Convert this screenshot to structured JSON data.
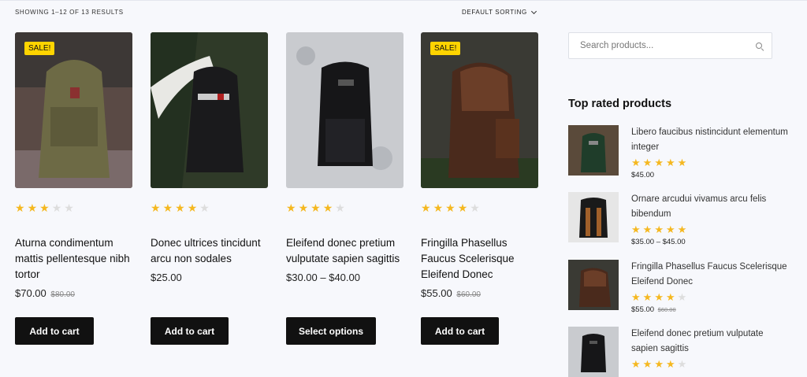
{
  "toolbar": {
    "results_text": "SHOWING 1–12 OF 13 RESULTS",
    "sort_label": "DEFAULT SORTING"
  },
  "products": [
    {
      "name": "Aturna condimentum mattis pellentesque nibh tortor",
      "price": "$70.00",
      "old_price": "$80.00",
      "sale": "SALE!",
      "rating": 3,
      "button": "Add to cart"
    },
    {
      "name": "Donec ultrices tincidunt arcu non sodales",
      "price": "$25.00",
      "old_price": "",
      "sale": "",
      "rating": 4,
      "button": "Add to cart"
    },
    {
      "name": "Eleifend donec pretium vulputate sapien sagittis",
      "price": "$30.00 – $40.00",
      "old_price": "",
      "sale": "",
      "rating": 4,
      "button": "Select options"
    },
    {
      "name": "Fringilla Phasellus Faucus Scelerisque Eleifend Donec",
      "price": "$55.00",
      "old_price": "$60.00",
      "sale": "SALE!",
      "rating": 4,
      "button": "Add to cart"
    }
  ],
  "sidebar": {
    "search_placeholder": "Search products...",
    "top_rated_title": "Top rated products",
    "top_rated": [
      {
        "name": "Libero faucibus nistincidunt elementum integer",
        "price": "$45.00",
        "old_price": "",
        "rating": 5
      },
      {
        "name": "Ornare arcudui vivamus arcu felis bibendum",
        "price": "$35.00 – $45.00",
        "old_price": "",
        "rating": 5
      },
      {
        "name": "Fringilla Phasellus Faucus Scelerisque Eleifend Donec",
        "price": "$55.00",
        "old_price": "$60.00",
        "rating": 4
      },
      {
        "name": "Eleifend donec pretium vulputate sapien sagittis",
        "price": "",
        "old_price": "",
        "rating": 4
      }
    ]
  },
  "icons": {
    "star": "★",
    "search": "search-icon",
    "chevron": "chevron-down-icon"
  },
  "colors": {
    "star_on": "#f5b820",
    "star_off": "#dddddd",
    "sale_badge": "#ffd400",
    "button_bg": "#111111"
  }
}
